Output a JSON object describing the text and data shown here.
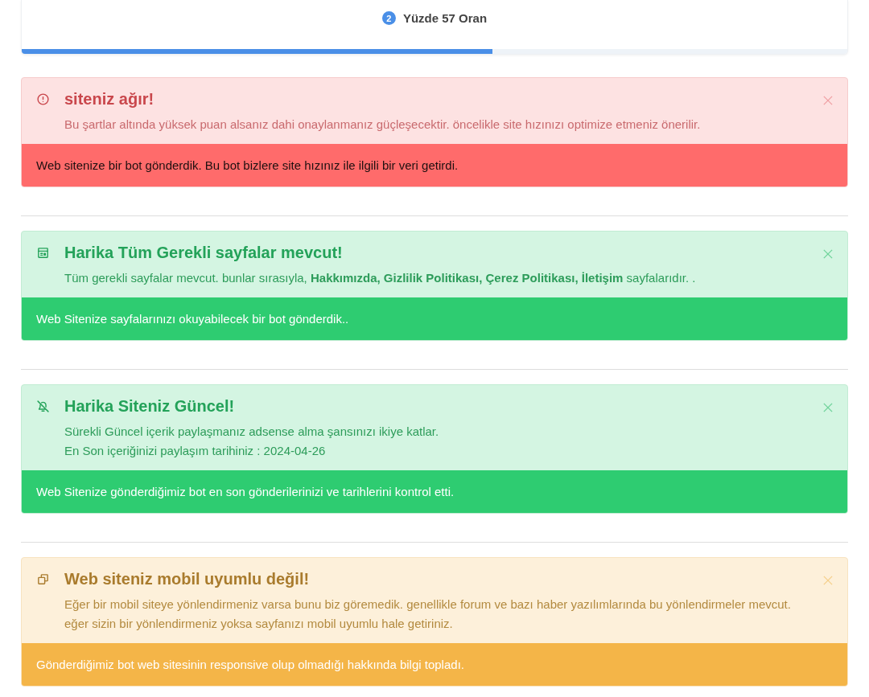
{
  "progress": {
    "step": "2",
    "label": "Yüzde 57 Oran",
    "level": 0.57
  },
  "alerts": [
    {
      "kind": "danger",
      "title": "siteniz ağır!",
      "lines": [
        "Bu şartlar altında yüksek puan alsanız dahi onaylanmanız güçleşecektir. öncelikle site hızınızı optimize etmeniz önerilir."
      ],
      "footer": "Web sitenize bir bot gönderdik. Bu bot bizlere site hızınız ile ilgili bir veri getirdi."
    },
    {
      "kind": "success",
      "title": "Harika Tüm Gerekli sayfalar mevcut!",
      "lines": [
        "Tüm gerekli sayfalar mevcut. bunlar sırasıyla, **Hakkımızda, Gizlilik Politikası, Çerez Politikası, İletişim** sayfalarıdır. ."
      ],
      "footer": "Web Sitenize sayfalarınızı okuyabilecek bir bot gönderdik.."
    },
    {
      "kind": "success",
      "title": "Harika Siteniz Güncel!",
      "lines": [
        "Sürekli Güncel içerik paylaşmanız adsense alma şansınızı ikiye katlar.",
        "En Son içeriğinizi paylaşım tarihiniz : 2024-04-26"
      ],
      "footer": "Web Sitenize gönderdiğimiz bot en son gönderilerinizi ve tarihlerini kontrol etti."
    },
    {
      "kind": "warning",
      "title": "Web siteniz mobil uyumlu değil!",
      "lines": [
        "Eğer bir mobil siteye yönlendirmeniz varsa bunu biz göremedik. genellikle forum ve bazı haber yazılımlarında bu yönlendirmeler mevcut.",
        "eğer sizin bir yönlendirmeniz yoksa sayfanızı mobil uyumlu hale getiriniz."
      ],
      "footer": "Gönderdiğimiz bot web sitesinin responsive olup olmadığı hakkında bilgi topladı."
    }
  ]
}
